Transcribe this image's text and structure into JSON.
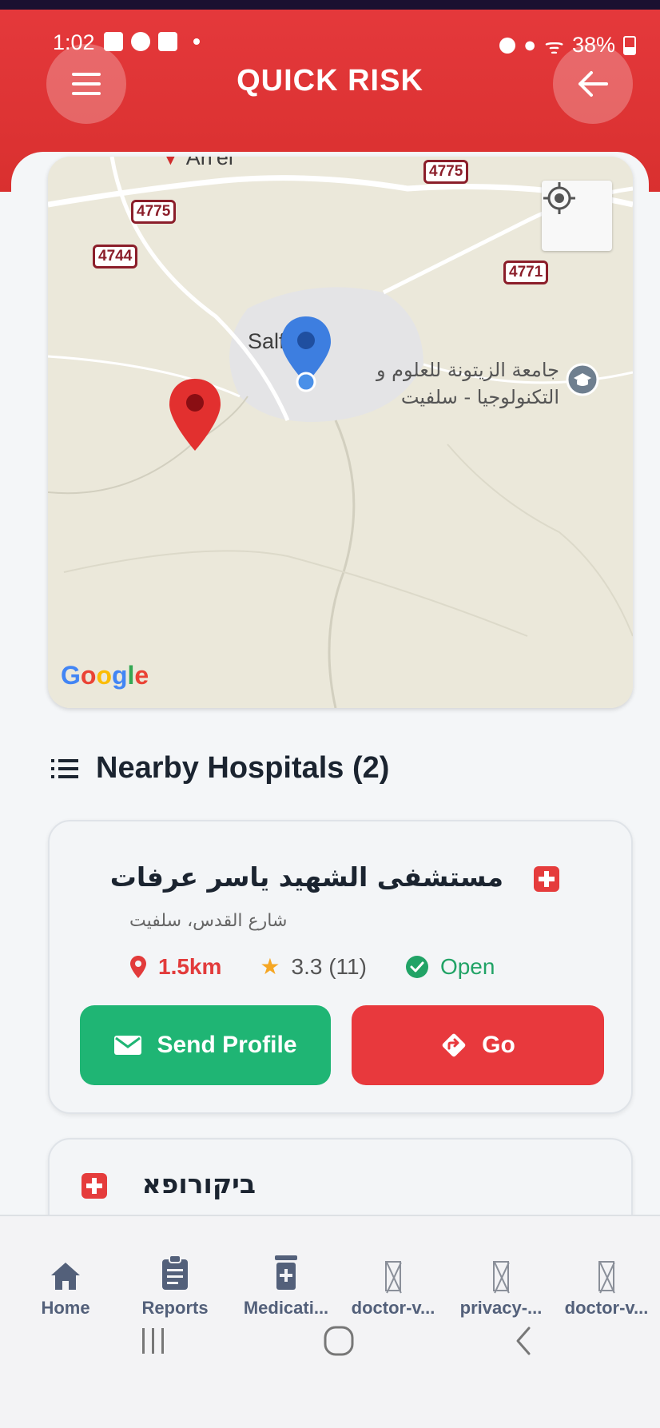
{
  "status_bar": {
    "time": "1:02",
    "battery": "38%"
  },
  "header": {
    "title": "QUICK RISK"
  },
  "map": {
    "road_tags": [
      "4775",
      "4775",
      "4744",
      "4771"
    ],
    "places": {
      "ariel": "Ari'el",
      "salfit": "Salfit"
    },
    "poi": {
      "line1": "جامعة الزيتونة للعلوم و",
      "line2": "التكنولوجيا - سلفيت"
    },
    "google_letters": [
      {
        "ch": "G",
        "color": "#4285F4"
      },
      {
        "ch": "o",
        "color": "#EA4335"
      },
      {
        "ch": "o",
        "color": "#FBBC05"
      },
      {
        "ch": "g",
        "color": "#4285F4"
      },
      {
        "ch": "l",
        "color": "#34A853"
      },
      {
        "ch": "e",
        "color": "#EA4335"
      }
    ]
  },
  "section": {
    "title": "Nearby Hospitals (2)"
  },
  "hospitals": [
    {
      "name": "مستشفى الشهيد ياسر عرفات",
      "address": "شارع القدس، سلفيت",
      "distance": "1.5km",
      "rating": "3.3 (11)",
      "status": "Open",
      "send_label": "Send Profile",
      "go_label": "Go"
    },
    {
      "name": "ביקורופא"
    }
  ],
  "bottom_nav": [
    {
      "label": "Home",
      "icon": "home-icon"
    },
    {
      "label": "Reports",
      "icon": "clipboard-icon"
    },
    {
      "label": "Medicati...",
      "icon": "medication-icon"
    },
    {
      "label": "doctor-v...",
      "icon": "broken-image-icon"
    },
    {
      "label": "privacy-...",
      "icon": "broken-image-icon"
    },
    {
      "label": "doctor-v...",
      "icon": "broken-image-icon"
    }
  ],
  "colors": {
    "primary": "#e5393c",
    "success": "#1fb574",
    "nav_text": "#53607a"
  }
}
